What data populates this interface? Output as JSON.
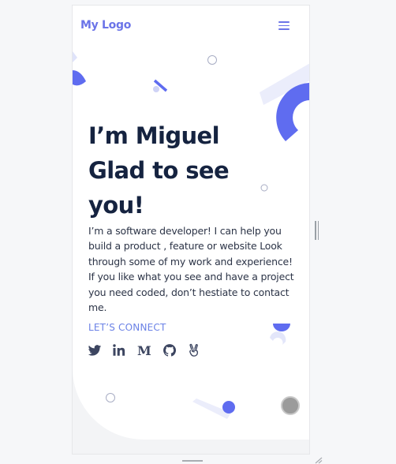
{
  "header": {
    "logo_text": "My Logo",
    "menu_icon": "hamburger-menu-icon"
  },
  "hero": {
    "title_lines": [
      "I’m Miguel",
      "Glad to see",
      "you!"
    ],
    "description": "I’m a software developer! I can help you build a product , feature or website Look through some of my work and experience! If you like what you see and have a project you need coded, don’t hestiate to contact me.",
    "connect_label": "LET’S CONNECT"
  },
  "socials": [
    {
      "name": "twitter",
      "icon": "twitter-icon"
    },
    {
      "name": "linkedin",
      "icon": "linkedin-icon"
    },
    {
      "name": "medium",
      "icon": "medium-icon",
      "glyph": "M"
    },
    {
      "name": "github",
      "icon": "github-icon"
    },
    {
      "name": "angellist",
      "icon": "angellist-icon"
    }
  ],
  "colors": {
    "accent": "#6b74e8",
    "accent_strong": "#5f6cf0",
    "heading": "#152340",
    "body_text": "#2c3447",
    "link": "#6b82e6",
    "decor_light": "#ebedfb",
    "icon": "#3c4560"
  },
  "controls": {
    "scroll_top_button": "scroll-to-top-button"
  }
}
